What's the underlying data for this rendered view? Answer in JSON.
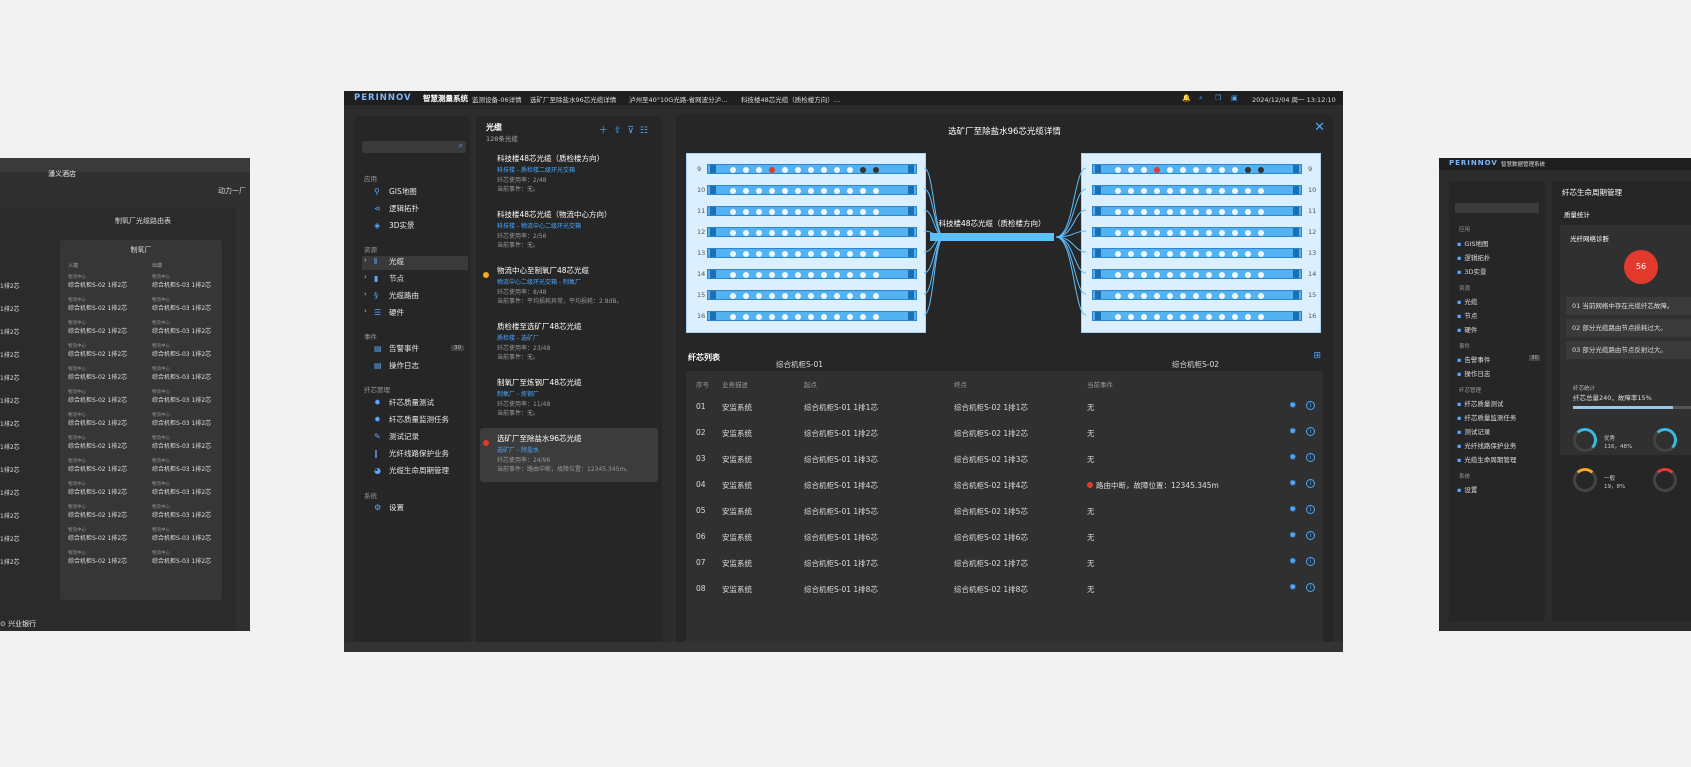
{
  "left_screen": {
    "poi": "潘义酒店",
    "power_label": "动力一厂",
    "panel_title": "制氧厂光缆路由表",
    "card_title": "制氧厂",
    "col_in": "入端",
    "col_out": "出端",
    "row_left": "综合机柜S-02 1排2芯",
    "row_sub": "物流中心",
    "row_right": "综合机柜S-03 1排2芯",
    "left_cut": "1排2芯",
    "bank": "兴业银行"
  },
  "main": {
    "logo": "PERINNOV",
    "system_name": "智慧测量系统",
    "tabs": [
      "监测设备-06详情",
      "选矿厂至除盐水96芯光缆详情",
      "泸州至40°10G光路-省网波分泸…",
      "科技楼48芯光缆（质检楼方向）…"
    ],
    "date": "2024/12/04 周一 13:12:10",
    "nav": {
      "search_placeholder": "",
      "sections": [
        "应用",
        "资源",
        "事件",
        "纤芯管理",
        "系统"
      ],
      "app_items": [
        {
          "label": "GIS地图",
          "icon": "map-pin-icon"
        },
        {
          "label": "逻辑拓扑",
          "icon": "share-icon"
        },
        {
          "label": "3D实景",
          "icon": "cube-icon"
        }
      ],
      "resource_items": [
        {
          "label": "光缆",
          "icon": "cable-icon"
        },
        {
          "label": "节点",
          "icon": "node-icon"
        },
        {
          "label": "光缆路由",
          "icon": "route-icon"
        },
        {
          "label": "硬件",
          "icon": "hardware-icon"
        }
      ],
      "event_items": [
        {
          "label": "告警事件",
          "badge": "30"
        },
        {
          "label": "操作日志"
        }
      ],
      "fiber_items": [
        "纤芯质量测试",
        "纤芯质量监测任务",
        "测试记录",
        "光纤线路保护业务",
        "光缆生命周期管理"
      ],
      "system_items": [
        "设置"
      ]
    },
    "cables": {
      "title": "光缆",
      "subtitle": "128条光缆",
      "items": [
        {
          "name": "科技楼48芯光缆（质检楼方向）",
          "route": "科技楼 - 质检楼二级环光交箱",
          "usage": "纤芯使用率：2/48",
          "event": "当前事件：无。",
          "status": "none"
        },
        {
          "name": "科技楼48芯光缆（物流中心方向）",
          "route": "科技楼 - 物流中心二级环光交箱",
          "usage": "纤芯使用率：2/56",
          "event": "当前事件：无。",
          "status": "none"
        },
        {
          "name": "物流中心至制氧厂48芯光缆",
          "route": "物流中心二级环光交箱 - 制氧厂",
          "usage": "纤芯使用率：8/48",
          "event": "当前事件：平均损耗异常，平均损耗：2.8dB。",
          "status": "warning"
        },
        {
          "name": "质检楼至选矿厂48芯光缆",
          "route": "质检楼 - 选矿厂",
          "usage": "纤芯使用率：23/48",
          "event": "当前事件：无。",
          "status": "none"
        },
        {
          "name": "制氧厂至炼钢厂48芯光缆",
          "route": "制氧厂 - 炼钢厂",
          "usage": "纤芯使用率：11/48",
          "event": "当前事件：无。",
          "status": "none"
        },
        {
          "name": "选矿厂至除盐水96芯光缆",
          "route": "选矿厂 - 除盐水",
          "usage": "纤芯使用率：24/96",
          "event": "当前事件：路由中断，故障位置：12345.345m。",
          "status": "alarm"
        }
      ]
    },
    "detail": {
      "title": "选矿厂至除盐水96芯光缆详情",
      "cabinet_left": "综合机柜S-01",
      "cabinet_right": "综合机柜S-02",
      "trunk_label": "科技楼48芯光缆（质检楼方向）",
      "port_numbers": [
        "9",
        "10",
        "11",
        "12",
        "13",
        "14",
        "15",
        "16"
      ],
      "fiber_list_title": "纤芯列表",
      "columns": [
        "序号",
        "业务描述",
        "起点",
        "终点",
        "当前事件"
      ],
      "rows": [
        {
          "no": "01",
          "desc": "安监系统",
          "start": "综合机柜S-01 1排1芯",
          "end": "综合机柜S-02 1排1芯",
          "event": "无",
          "alarm": false
        },
        {
          "no": "02",
          "desc": "安监系统",
          "start": "综合机柜S-01 1排2芯",
          "end": "综合机柜S-02 1排2芯",
          "event": "无",
          "alarm": false
        },
        {
          "no": "03",
          "desc": "安监系统",
          "start": "综合机柜S-01 1排3芯",
          "end": "综合机柜S-02 1排3芯",
          "event": "无",
          "alarm": false
        },
        {
          "no": "04",
          "desc": "安监系统",
          "start": "综合机柜S-01 1排4芯",
          "end": "综合机柜S-02 1排4芯",
          "event": "路由中断，故障位置：12345.345m",
          "alarm": true
        },
        {
          "no": "05",
          "desc": "安监系统",
          "start": "综合机柜S-01 1排5芯",
          "end": "综合机柜S-02 1排5芯",
          "event": "无",
          "alarm": false
        },
        {
          "no": "06",
          "desc": "安监系统",
          "start": "综合机柜S-01 1排6芯",
          "end": "综合机柜S-02 1排6芯",
          "event": "无",
          "alarm": false
        },
        {
          "no": "07",
          "desc": "安监系统",
          "start": "综合机柜S-01 1排7芯",
          "end": "综合机柜S-02 1排7芯",
          "event": "无",
          "alarm": false
        },
        {
          "no": "08",
          "desc": "安监系统",
          "start": "综合机柜S-01 1排8芯",
          "end": "综合机柜S-02 1排8芯",
          "event": "无",
          "alarm": false
        }
      ]
    },
    "bottom_bank": "兴业银行"
  },
  "right_screen": {
    "logo": "PERINNOV",
    "system_name": "智慧数据管理系统",
    "panel_title": "纤芯生命周期管理",
    "section_title": "质量统计",
    "box_title": "光纤网络诊断",
    "score": "56",
    "diag_rows": [
      "01   当前网络中存在光缆纤芯故障。",
      "02   部分光缆路由节点损耗过大。",
      "03   部分光缆路由节点反射过大。"
    ],
    "stat_label": "纤芯统计",
    "stat_text": "纤芯总量240，故障率15%",
    "fault_rate": 0.15,
    "ring_labels": [
      {
        "name": "优秀",
        "value": "116，48%"
      },
      {
        "name": "一般",
        "value": "19，8%"
      }
    ],
    "nav_sections": [
      "应用",
      "资源",
      "事件",
      "纤芯管理",
      "系统"
    ],
    "nav_items": [
      "GIS地图",
      "逻辑拓扑",
      "3D实景",
      "光缆",
      "节点",
      "硬件",
      "告警事件",
      "操作日志",
      "纤芯质量测试",
      "纤芯质量监测任务",
      "测试记录",
      "光纤线路保护业务",
      "光缆生命周期管理",
      "设置"
    ],
    "alarm_badge": "30"
  }
}
